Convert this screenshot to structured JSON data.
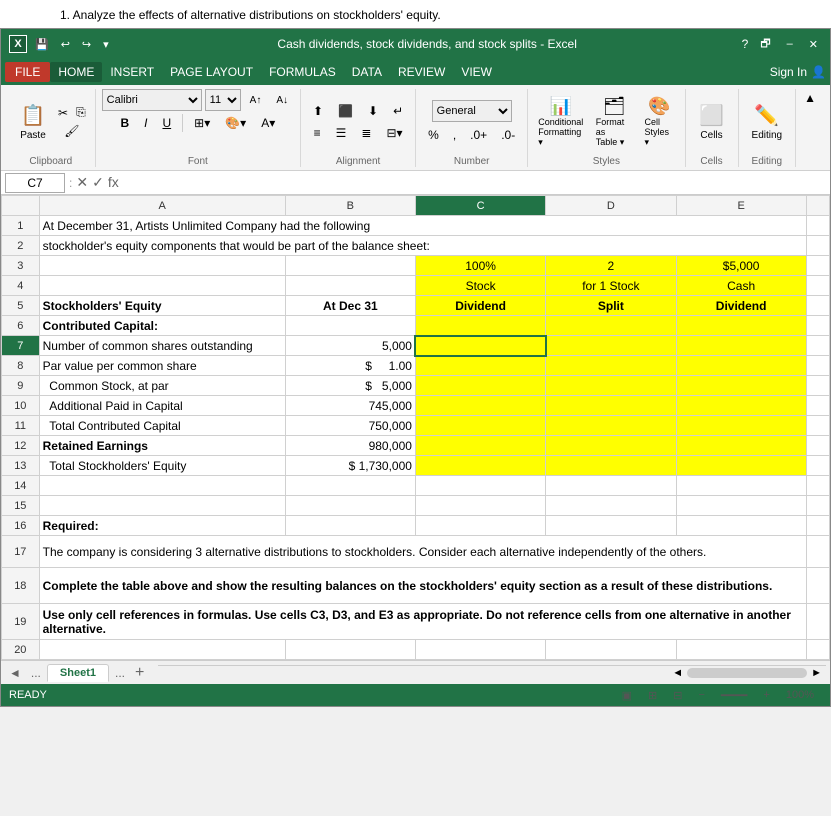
{
  "instruction": "1. Analyze the effects of alternative distributions on stockholders' equity.",
  "title_bar": {
    "title": "Cash dividends, stock dividends, and stock splits - Excel",
    "help": "?",
    "restore": "🗗",
    "minimize": "–",
    "close": "✕"
  },
  "menu": {
    "file": "FILE",
    "items": [
      "HOME",
      "INSERT",
      "PAGE LAYOUT",
      "FORMULAS",
      "DATA",
      "REVIEW",
      "VIEW"
    ],
    "sign_in": "Sign In"
  },
  "ribbon": {
    "clipboard_label": "Clipboard",
    "font_label": "Font",
    "alignment_label": "Alignment",
    "number_label": "Number",
    "styles_label": "Styles",
    "cells_label": "Cells",
    "editing_label": "Editing",
    "paste_label": "Paste",
    "font_name": "Calibri",
    "font_size": "11",
    "conditional_formatting": "Conditional Formatting ▾",
    "format_as_table": "Format as Table ▾",
    "cell_styles": "Cell Styles ▾",
    "cells_btn": "Cells",
    "editing_btn": "Editing"
  },
  "formula_bar": {
    "cell_ref": "C7",
    "formula": ""
  },
  "col_headers": [
    "",
    "A",
    "B",
    "C",
    "D",
    "E"
  ],
  "rows": [
    {
      "num": 1,
      "cells": [
        "At December 31,  Artists Unlimited Company had the following",
        "",
        "",
        "",
        ""
      ]
    },
    {
      "num": 2,
      "cells": [
        "stockholder's equity components that would be part of the balance sheet:",
        "",
        "",
        "",
        ""
      ]
    },
    {
      "num": 3,
      "cells": [
        "",
        "",
        "100%",
        "2",
        "$5,000"
      ]
    },
    {
      "num": 4,
      "cells": [
        "",
        "",
        "Stock",
        "for 1 Stock",
        "Cash"
      ]
    },
    {
      "num": 5,
      "cells": [
        "Stockholders' Equity",
        "At Dec 31",
        "Dividend",
        "Split",
        "Dividend"
      ]
    },
    {
      "num": 6,
      "cells": [
        "Contributed Capital:",
        "",
        "",
        "",
        ""
      ]
    },
    {
      "num": 7,
      "cells": [
        "Number of common shares outstanding",
        "5,000",
        "",
        "",
        ""
      ],
      "active_col": "C"
    },
    {
      "num": 8,
      "cells": [
        "Par value per common share",
        "$ 1.00",
        "",
        "",
        ""
      ]
    },
    {
      "num": 9,
      "cells": [
        "  Common Stock, at par",
        "$ 5,000",
        "",
        "",
        ""
      ]
    },
    {
      "num": 10,
      "cells": [
        "  Additional Paid in Capital",
        "745,000",
        "",
        "",
        ""
      ]
    },
    {
      "num": 11,
      "cells": [
        "  Total Contributed Capital",
        "750,000",
        "",
        "",
        ""
      ]
    },
    {
      "num": 12,
      "cells": [
        "Retained Earnings",
        "980,000",
        "",
        "",
        ""
      ]
    },
    {
      "num": 13,
      "cells": [
        "  Total Stockholders' Equity",
        "$ 1,730,000",
        "",
        "",
        ""
      ]
    },
    {
      "num": 14,
      "cells": [
        "",
        "",
        "",
        "",
        ""
      ]
    },
    {
      "num": 15,
      "cells": [
        "",
        "",
        "",
        "",
        ""
      ]
    },
    {
      "num": 16,
      "cells": [
        "Required:",
        "",
        "",
        "",
        ""
      ]
    },
    {
      "num": 17,
      "cells": [
        "The company is considering 3 alternative distributions to stockholders.  Consider each alternative independently of the others.",
        "",
        "",
        "",
        ""
      ]
    },
    {
      "num": 18,
      "cells": [
        "Complete the table above and show the resulting balances on the stockholders' equity section as a result of these distributions.",
        "",
        "",
        "",
        ""
      ]
    },
    {
      "num": 19,
      "cells": [
        "Use only cell references in formulas.  Use cells C3, D3, and E3 as appropriate.  Do not reference cells from one alternative in another alternative.",
        "",
        "",
        "",
        ""
      ]
    },
    {
      "num": 20,
      "cells": [
        "",
        "",
        "",
        "",
        ""
      ]
    }
  ],
  "sheet_tabs": {
    "prev": "◄",
    "ellipsis1": "...",
    "active": "Sheet1",
    "ellipsis2": "...",
    "add": "+"
  },
  "status_bar": {
    "ready": "READY"
  }
}
